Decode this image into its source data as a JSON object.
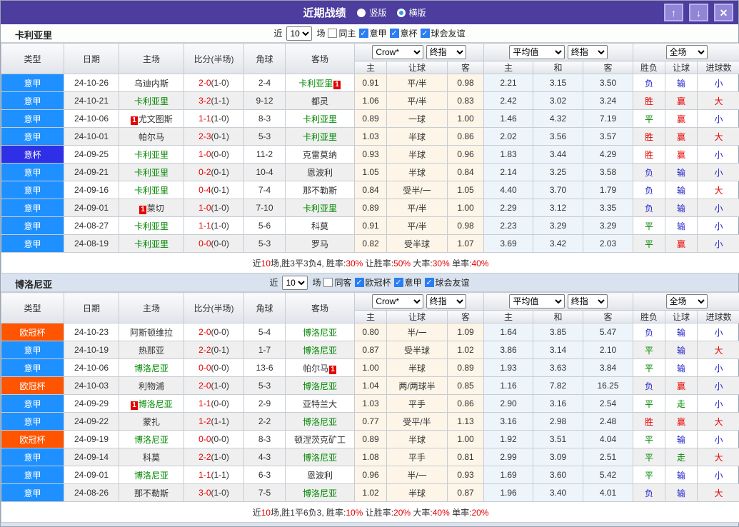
{
  "titlebar": {
    "title": "近期战绩",
    "radio_selected": "竖版",
    "radio_unselected": "横版",
    "buttons": {
      "up": "↑",
      "down": "↓",
      "close": "✕"
    }
  },
  "badge_text": "1",
  "colors": {
    "titlebar_bg": "#4c3d9e",
    "league": {
      "意甲": "#1e90ff",
      "意杯": "#2f2fe8",
      "欧冠杯": "#ff5500"
    },
    "team_green": "#008800",
    "score_red": "#e60000",
    "result": {
      "胜": "#e60000",
      "平": "#008800",
      "负": "#2727cc",
      "赢": "#e60000",
      "走": "#008800",
      "输": "#2727cc",
      "大": "#e60000",
      "小": "#2727cc"
    }
  },
  "table_header": {
    "static": [
      "类型",
      "日期",
      "主场",
      "比分(半场)",
      "角球",
      "客场"
    ],
    "selects": {
      "odds_source": "Crow*",
      "odds_stage": "终指",
      "avg_source": "平均值",
      "avg_stage": "终指",
      "scope": "全场"
    },
    "sub": [
      "主",
      "让球",
      "客",
      "主",
      "和",
      "客",
      "胜负",
      "让球",
      "进球数"
    ]
  },
  "sections": [
    {
      "team": "卡利亚里",
      "filter": {
        "prefix": "近",
        "matches": "10",
        "suffix": "场",
        "unchecked": "同主",
        "checked": [
          "意甲",
          "意杯",
          "球会友谊"
        ]
      },
      "rows": [
        {
          "league": "意甲",
          "date": "24-10-26",
          "home": {
            "name": "乌迪内斯"
          },
          "score": {
            "ft": "2-0",
            "ht": "(1-0)"
          },
          "corner": "2-4",
          "away": {
            "name": "卡利亚里",
            "green": true,
            "badge": "after"
          },
          "odds": [
            "0.91",
            "平/半",
            "0.98"
          ],
          "avg": [
            "2.21",
            "3.15",
            "3.50"
          ],
          "result": [
            "负",
            "输",
            "小"
          ]
        },
        {
          "league": "意甲",
          "date": "24-10-21",
          "home": {
            "name": "卡利亚里",
            "green": true
          },
          "score": {
            "ft": "3-2",
            "ht": "(1-1)"
          },
          "corner": "9-12",
          "away": {
            "name": "都灵"
          },
          "odds": [
            "1.06",
            "平/半",
            "0.83"
          ],
          "avg": [
            "2.42",
            "3.02",
            "3.24"
          ],
          "result": [
            "胜",
            "赢",
            "大"
          ]
        },
        {
          "league": "意甲",
          "date": "24-10-06",
          "home": {
            "name": "尤文图斯",
            "badge": "before"
          },
          "score": {
            "ft": "1-1",
            "ht": "(1-0)"
          },
          "corner": "8-3",
          "away": {
            "name": "卡利亚里",
            "green": true
          },
          "odds": [
            "0.89",
            "一球",
            "1.00"
          ],
          "avg": [
            "1.46",
            "4.32",
            "7.19"
          ],
          "result": [
            "平",
            "赢",
            "小"
          ]
        },
        {
          "league": "意甲",
          "date": "24-10-01",
          "home": {
            "name": "帕尔马"
          },
          "score": {
            "ft": "2-3",
            "ht": "(0-1)"
          },
          "corner": "5-3",
          "away": {
            "name": "卡利亚里",
            "green": true
          },
          "odds": [
            "1.03",
            "半球",
            "0.86"
          ],
          "avg": [
            "2.02",
            "3.56",
            "3.57"
          ],
          "result": [
            "胜",
            "赢",
            "大"
          ]
        },
        {
          "league": "意杯",
          "date": "24-09-25",
          "home": {
            "name": "卡利亚里",
            "green": true
          },
          "score": {
            "ft": "1-0",
            "ht": "(0-0)"
          },
          "corner": "11-2",
          "away": {
            "name": "克雷莫纳"
          },
          "odds": [
            "0.93",
            "半球",
            "0.96"
          ],
          "avg": [
            "1.83",
            "3.44",
            "4.29"
          ],
          "result": [
            "胜",
            "赢",
            "小"
          ]
        },
        {
          "league": "意甲",
          "date": "24-09-21",
          "home": {
            "name": "卡利亚里",
            "green": true
          },
          "score": {
            "ft": "0-2",
            "ht": "(0-1)"
          },
          "corner": "10-4",
          "away": {
            "name": "恩波利"
          },
          "odds": [
            "1.05",
            "半球",
            "0.84"
          ],
          "avg": [
            "2.14",
            "3.25",
            "3.58"
          ],
          "result": [
            "负",
            "输",
            "小"
          ]
        },
        {
          "league": "意甲",
          "date": "24-09-16",
          "home": {
            "name": "卡利亚里",
            "green": true
          },
          "score": {
            "ft": "0-4",
            "ht": "(0-1)"
          },
          "corner": "7-4",
          "away": {
            "name": "那不勒斯"
          },
          "odds": [
            "0.84",
            "受半/一",
            "1.05"
          ],
          "avg": [
            "4.40",
            "3.70",
            "1.79"
          ],
          "result": [
            "负",
            "输",
            "大"
          ]
        },
        {
          "league": "意甲",
          "date": "24-09-01",
          "home": {
            "name": "莱切",
            "badge": "before"
          },
          "score": {
            "ft": "1-0",
            "ht": "(1-0)"
          },
          "corner": "7-10",
          "away": {
            "name": "卡利亚里",
            "green": true
          },
          "odds": [
            "0.89",
            "平/半",
            "1.00"
          ],
          "avg": [
            "2.29",
            "3.12",
            "3.35"
          ],
          "result": [
            "负",
            "输",
            "小"
          ]
        },
        {
          "league": "意甲",
          "date": "24-08-27",
          "home": {
            "name": "卡利亚里",
            "green": true
          },
          "score": {
            "ft": "1-1",
            "ht": "(1-0)"
          },
          "corner": "5-6",
          "away": {
            "name": "科莫"
          },
          "odds": [
            "0.91",
            "平/半",
            "0.98"
          ],
          "avg": [
            "2.23",
            "3.29",
            "3.29"
          ],
          "result": [
            "平",
            "输",
            "小"
          ]
        },
        {
          "league": "意甲",
          "date": "24-08-19",
          "home": {
            "name": "卡利亚里",
            "green": true
          },
          "score": {
            "ft": "0-0",
            "ht": "(0-0)"
          },
          "corner": "5-3",
          "away": {
            "name": "罗马"
          },
          "odds": [
            "0.82",
            "受半球",
            "1.07"
          ],
          "avg": [
            "3.69",
            "3.42",
            "2.03"
          ],
          "result": [
            "平",
            "赢",
            "小"
          ]
        }
      ],
      "summary": [
        {
          "t": "近"
        },
        {
          "t": "10",
          "red": true
        },
        {
          "t": "场,胜3平3负4, 胜率:"
        },
        {
          "t": "30%",
          "red": true
        },
        {
          "t": " 让胜率:"
        },
        {
          "t": "50%",
          "red": true
        },
        {
          "t": " 大率:"
        },
        {
          "t": "30%",
          "red": true
        },
        {
          "t": " 单率:"
        },
        {
          "t": "40%",
          "red": true
        }
      ]
    },
    {
      "team": "博洛尼亚",
      "filter": {
        "prefix": "近",
        "matches": "10",
        "suffix": "场",
        "unchecked": "同客",
        "checked": [
          "欧冠杯",
          "意甲",
          "球会友谊"
        ]
      },
      "rows": [
        {
          "league": "欧冠杯",
          "date": "24-10-23",
          "home": {
            "name": "阿斯顿维拉"
          },
          "score": {
            "ft": "2-0",
            "ht": "(0-0)"
          },
          "corner": "5-4",
          "away": {
            "name": "博洛尼亚",
            "green": true
          },
          "odds": [
            "0.80",
            "半/一",
            "1.09"
          ],
          "avg": [
            "1.64",
            "3.85",
            "5.47"
          ],
          "result": [
            "负",
            "输",
            "小"
          ]
        },
        {
          "league": "意甲",
          "date": "24-10-19",
          "home": {
            "name": "热那亚"
          },
          "score": {
            "ft": "2-2",
            "ht": "(0-1)"
          },
          "corner": "1-7",
          "away": {
            "name": "博洛尼亚",
            "green": true
          },
          "odds": [
            "0.87",
            "受半球",
            "1.02"
          ],
          "avg": [
            "3.86",
            "3.14",
            "2.10"
          ],
          "result": [
            "平",
            "输",
            "大"
          ]
        },
        {
          "league": "意甲",
          "date": "24-10-06",
          "home": {
            "name": "博洛尼亚",
            "green": true
          },
          "score": {
            "ft": "0-0",
            "ht": "(0-0)"
          },
          "corner": "13-6",
          "away": {
            "name": "帕尔马",
            "badge": "after"
          },
          "odds": [
            "1.00",
            "半球",
            "0.89"
          ],
          "avg": [
            "1.93",
            "3.63",
            "3.84"
          ],
          "result": [
            "平",
            "输",
            "小"
          ]
        },
        {
          "league": "欧冠杯",
          "date": "24-10-03",
          "home": {
            "name": "利物浦"
          },
          "score": {
            "ft": "2-0",
            "ht": "(1-0)"
          },
          "corner": "5-3",
          "away": {
            "name": "博洛尼亚",
            "green": true
          },
          "odds": [
            "1.04",
            "两/两球半",
            "0.85"
          ],
          "avg": [
            "1.16",
            "7.82",
            "16.25"
          ],
          "result": [
            "负",
            "赢",
            "小"
          ]
        },
        {
          "league": "意甲",
          "date": "24-09-29",
          "home": {
            "name": "博洛尼亚",
            "green": true,
            "badge": "before"
          },
          "score": {
            "ft": "1-1",
            "ht": "(0-0)"
          },
          "corner": "2-9",
          "away": {
            "name": "亚特兰大"
          },
          "odds": [
            "1.03",
            "平手",
            "0.86"
          ],
          "avg": [
            "2.90",
            "3.16",
            "2.54"
          ],
          "result": [
            "平",
            "走",
            "小"
          ]
        },
        {
          "league": "意甲",
          "date": "24-09-22",
          "home": {
            "name": "蒙扎"
          },
          "score": {
            "ft": "1-2",
            "ht": "(1-1)"
          },
          "corner": "2-2",
          "away": {
            "name": "博洛尼亚",
            "green": true
          },
          "odds": [
            "0.77",
            "受平/半",
            "1.13"
          ],
          "avg": [
            "3.16",
            "2.98",
            "2.48"
          ],
          "result": [
            "胜",
            "赢",
            "大"
          ]
        },
        {
          "league": "欧冠杯",
          "date": "24-09-19",
          "home": {
            "name": "博洛尼亚",
            "green": true
          },
          "score": {
            "ft": "0-0",
            "ht": "(0-0)"
          },
          "corner": "8-3",
          "away": {
            "name": "顿涅茨克矿工"
          },
          "odds": [
            "0.89",
            "半球",
            "1.00"
          ],
          "avg": [
            "1.92",
            "3.51",
            "4.04"
          ],
          "result": [
            "平",
            "输",
            "小"
          ]
        },
        {
          "league": "意甲",
          "date": "24-09-14",
          "home": {
            "name": "科莫"
          },
          "score": {
            "ft": "2-2",
            "ht": "(1-0)"
          },
          "corner": "4-3",
          "away": {
            "name": "博洛尼亚",
            "green": true
          },
          "odds": [
            "1.08",
            "平手",
            "0.81"
          ],
          "avg": [
            "2.99",
            "3.09",
            "2.51"
          ],
          "result": [
            "平",
            "走",
            "大"
          ]
        },
        {
          "league": "意甲",
          "date": "24-09-01",
          "home": {
            "name": "博洛尼亚",
            "green": true
          },
          "score": {
            "ft": "1-1",
            "ht": "(1-1)"
          },
          "corner": "6-3",
          "away": {
            "name": "恩波利"
          },
          "odds": [
            "0.96",
            "半/一",
            "0.93"
          ],
          "avg": [
            "1.69",
            "3.60",
            "5.42"
          ],
          "result": [
            "平",
            "输",
            "小"
          ]
        },
        {
          "league": "意甲",
          "date": "24-08-26",
          "home": {
            "name": "那不勒斯"
          },
          "score": {
            "ft": "3-0",
            "ht": "(1-0)"
          },
          "corner": "7-5",
          "away": {
            "name": "博洛尼亚",
            "green": true
          },
          "odds": [
            "1.02",
            "半球",
            "0.87"
          ],
          "avg": [
            "1.96",
            "3.40",
            "4.01"
          ],
          "result": [
            "负",
            "输",
            "大"
          ]
        }
      ],
      "summary": [
        {
          "t": "近"
        },
        {
          "t": "10",
          "red": true
        },
        {
          "t": "场,胜1平6负3, 胜率:"
        },
        {
          "t": "10%",
          "red": true
        },
        {
          "t": " 让胜率:"
        },
        {
          "t": "20%",
          "red": true
        },
        {
          "t": " 大率:"
        },
        {
          "t": "40%",
          "red": true
        },
        {
          "t": " 单率:"
        },
        {
          "t": "20%",
          "red": true
        }
      ]
    }
  ]
}
